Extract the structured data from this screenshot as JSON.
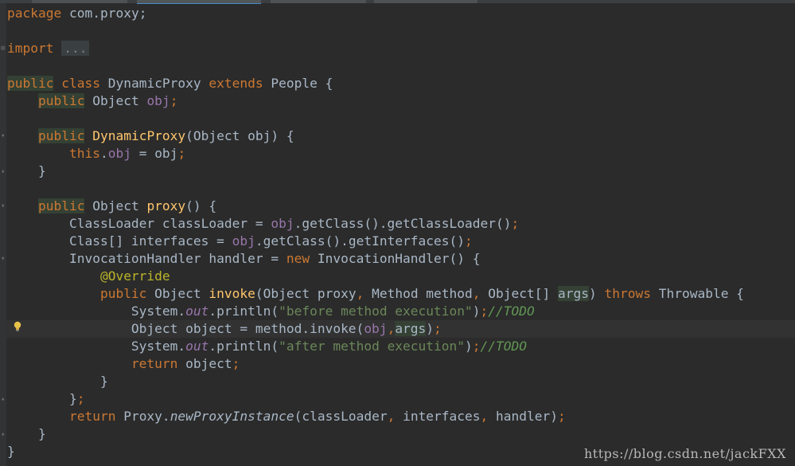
{
  "editor": {
    "lines": [
      [
        {
          "t": "package",
          "c": "kw"
        },
        {
          "t": " com.proxy;",
          "c": ""
        }
      ],
      [],
      [
        {
          "t": "import",
          "c": "kw"
        },
        {
          "t": " ",
          "c": ""
        },
        {
          "t": "...",
          "c": "fold-txt"
        }
      ],
      [],
      [
        {
          "t": "public",
          "c": "kwhl"
        },
        {
          "t": " ",
          "c": ""
        },
        {
          "t": "class",
          "c": "kw"
        },
        {
          "t": " DynamicProxy ",
          "c": ""
        },
        {
          "t": "extends",
          "c": "kw"
        },
        {
          "t": " People {",
          "c": ""
        }
      ],
      [
        {
          "t": "    ",
          "c": ""
        },
        {
          "t": "public",
          "c": "kwhl"
        },
        {
          "t": " Object ",
          "c": ""
        },
        {
          "t": "obj",
          "c": "fld"
        },
        {
          "t": ";",
          "c": "kw"
        }
      ],
      [],
      [
        {
          "t": "    ",
          "c": ""
        },
        {
          "t": "public",
          "c": "kwhl"
        },
        {
          "t": " ",
          "c": ""
        },
        {
          "t": "DynamicProxy",
          "c": "fn"
        },
        {
          "t": "(Object obj) {",
          "c": ""
        }
      ],
      [
        {
          "t": "        ",
          "c": ""
        },
        {
          "t": "this",
          "c": "kw"
        },
        {
          "t": ".",
          "c": ""
        },
        {
          "t": "obj",
          "c": "fld"
        },
        {
          "t": " = obj",
          "c": ""
        },
        {
          "t": ";",
          "c": "kw"
        }
      ],
      [
        {
          "t": "    }",
          "c": ""
        }
      ],
      [],
      [
        {
          "t": "    ",
          "c": ""
        },
        {
          "t": "public",
          "c": "kwhl"
        },
        {
          "t": " Object ",
          "c": ""
        },
        {
          "t": "proxy",
          "c": "fn"
        },
        {
          "t": "() {",
          "c": ""
        }
      ],
      [
        {
          "t": "        ClassLoader classLoader = ",
          "c": ""
        },
        {
          "t": "obj",
          "c": "fld"
        },
        {
          "t": ".getClass().getClassLoader()",
          "c": ""
        },
        {
          "t": ";",
          "c": "kw"
        }
      ],
      [
        {
          "t": "        Class[] interfaces = ",
          "c": ""
        },
        {
          "t": "obj",
          "c": "fld"
        },
        {
          "t": ".getClass().getInterfaces()",
          "c": ""
        },
        {
          "t": ";",
          "c": "kw"
        }
      ],
      [
        {
          "t": "        InvocationHandler handler = ",
          "c": ""
        },
        {
          "t": "new",
          "c": "kw"
        },
        {
          "t": " InvocationHandler() {",
          "c": ""
        }
      ],
      [
        {
          "t": "            ",
          "c": ""
        },
        {
          "t": "@Override",
          "c": "ann"
        }
      ],
      [
        {
          "t": "            ",
          "c": ""
        },
        {
          "t": "public",
          "c": "kw"
        },
        {
          "t": " Object ",
          "c": ""
        },
        {
          "t": "invoke",
          "c": "fn"
        },
        {
          "t": "(Object proxy",
          "c": ""
        },
        {
          "t": ",",
          "c": "kw"
        },
        {
          "t": " Method method",
          "c": ""
        },
        {
          "t": ",",
          "c": "kw"
        },
        {
          "t": " Object[] ",
          "c": ""
        },
        {
          "t": "args",
          "c": "argref"
        },
        {
          "t": ") ",
          "c": ""
        },
        {
          "t": "throws",
          "c": "kw"
        },
        {
          "t": " Throwable {",
          "c": ""
        }
      ],
      [
        {
          "t": "                System.",
          "c": ""
        },
        {
          "t": "out",
          "c": "fldi"
        },
        {
          "t": ".println(",
          "c": ""
        },
        {
          "t": "\"before method execution\"",
          "c": "str"
        },
        {
          "t": ")",
          "c": ""
        },
        {
          "t": ";",
          "c": "kw"
        },
        {
          "t": "//",
          "c": "cmt"
        },
        {
          "t": "TODO",
          "c": "cmt"
        }
      ],
      [
        {
          "t": "                Object object = method.invoke(",
          "c": ""
        },
        {
          "t": "obj",
          "c": "fld"
        },
        {
          "t": ",",
          "c": "kw"
        },
        {
          "t": "args",
          "c": "argref"
        },
        {
          "t": ")",
          "c": ""
        },
        {
          "t": ";",
          "c": "kw"
        }
      ],
      [
        {
          "t": "                System.",
          "c": ""
        },
        {
          "t": "out",
          "c": "fldi"
        },
        {
          "t": ".println(",
          "c": ""
        },
        {
          "t": "\"after method execution\"",
          "c": "str"
        },
        {
          "t": ")",
          "c": ""
        },
        {
          "t": ";",
          "c": "kw"
        },
        {
          "t": "//",
          "c": "cmt"
        },
        {
          "t": "TODO",
          "c": "cmt"
        }
      ],
      [
        {
          "t": "                ",
          "c": ""
        },
        {
          "t": "return",
          "c": "kw"
        },
        {
          "t": " object",
          "c": ""
        },
        {
          "t": ";",
          "c": "kw"
        }
      ],
      [
        {
          "t": "            }",
          "c": ""
        }
      ],
      [
        {
          "t": "        }",
          "c": ""
        },
        {
          "t": ";",
          "c": "kw"
        }
      ],
      [
        {
          "t": "        ",
          "c": ""
        },
        {
          "t": "return",
          "c": "kw"
        },
        {
          "t": " Proxy.",
          "c": ""
        },
        {
          "t": "newProxyInstance",
          "c": "ita"
        },
        {
          "t": "(classLoader",
          "c": ""
        },
        {
          "t": ",",
          "c": "kw"
        },
        {
          "t": " interfaces",
          "c": ""
        },
        {
          "t": ",",
          "c": "kw"
        },
        {
          "t": " handler)",
          "c": ""
        },
        {
          "t": ";",
          "c": "kw"
        }
      ],
      [
        {
          "t": "    }",
          "c": ""
        }
      ],
      [
        {
          "t": "}",
          "c": ""
        }
      ]
    ]
  },
  "watermark": "https://blog.csdn.net/jackFXX",
  "colors": {
    "background": "#2b2b2b",
    "keyword": "#cc7832",
    "method": "#ffc66d",
    "field": "#9876aa",
    "string": "#6a8759",
    "annotation": "#bbb529",
    "comment": "#629755"
  },
  "icons": {
    "intention": "lightbulb-icon",
    "fold_markers": "fold-marker-icon"
  }
}
